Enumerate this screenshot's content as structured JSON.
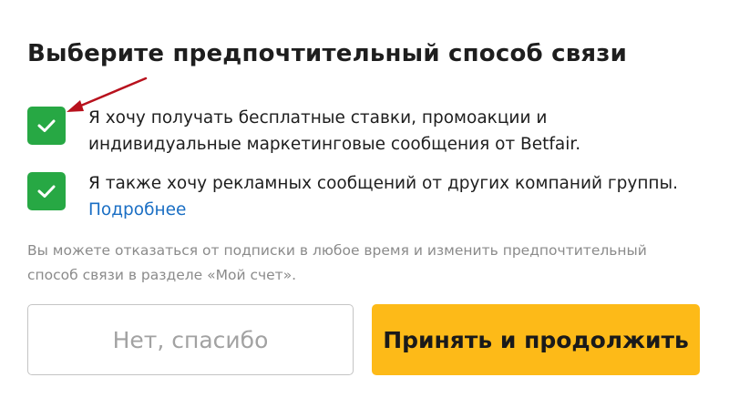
{
  "page": {
    "title": "Выберите предпочтительный способ связи"
  },
  "options": [
    {
      "checked": true,
      "lines": [
        "Я хочу получать бесплатные ставки, промоакции и",
        "индивидуальные маркетинговые сообщения от Betfair."
      ]
    },
    {
      "checked": true,
      "lines": [
        "Я также хочу рекламных сообщений от других компаний группы."
      ],
      "link": "Подробнее"
    }
  ],
  "disclaimer": {
    "lines": [
      "Вы можете отказаться от подписки в любое время и изменить предпочтительный",
      "способ связи в разделе «Мой счет»."
    ]
  },
  "buttons": {
    "decline": "Нет, спасибо",
    "accept": "Принять и продолжить"
  },
  "colors": {
    "checkbox": "#27a844",
    "link": "#1b6fc4",
    "accept_button": "#fdba18",
    "annotation_arrow": "#b8111d"
  },
  "icons": {
    "checkbox_mark": "checkmark-icon",
    "annotation": "annotation-arrow-icon"
  }
}
